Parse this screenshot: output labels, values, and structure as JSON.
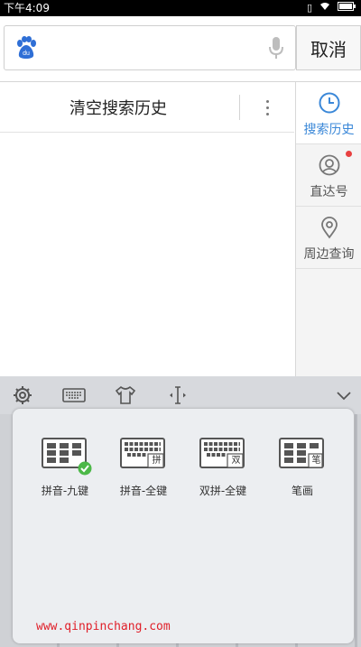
{
  "status_bar": {
    "time": "下午4:09",
    "icons": [
      "sim-icon",
      "wifi-icon",
      "battery-icon"
    ]
  },
  "search": {
    "placeholder": "",
    "logo_icon": "baidu-paw-icon",
    "mic_icon": "microphone-icon",
    "cancel_label": "取消"
  },
  "history": {
    "clear_label": "清空搜索历史"
  },
  "side_nav": {
    "items": [
      {
        "label": "搜索历史",
        "icon": "clock-icon",
        "active": true
      },
      {
        "label": "直达号",
        "icon": "person-icon",
        "active": false,
        "badge": true
      },
      {
        "label": "周边查询",
        "icon": "location-pin-icon",
        "active": false
      }
    ]
  },
  "keyboard": {
    "toolbar_icons": [
      "gear-icon",
      "keyboard-icon",
      "shirt-icon",
      "cursor-move-icon",
      "chevron-down-icon"
    ],
    "options": [
      {
        "label": "拼音-九键",
        "badge": "",
        "selected": true
      },
      {
        "label": "拼音-全键",
        "badge": "拼",
        "selected": false
      },
      {
        "label": "双拼-全键",
        "badge": "双",
        "selected": false
      },
      {
        "label": "笔画",
        "badge": "笔",
        "selected": false
      }
    ]
  },
  "watermark": "www.qinpinchang.com",
  "colors": {
    "accent": "#3b88d8",
    "badge_red": "#e84040",
    "check_green": "#4cb848"
  }
}
